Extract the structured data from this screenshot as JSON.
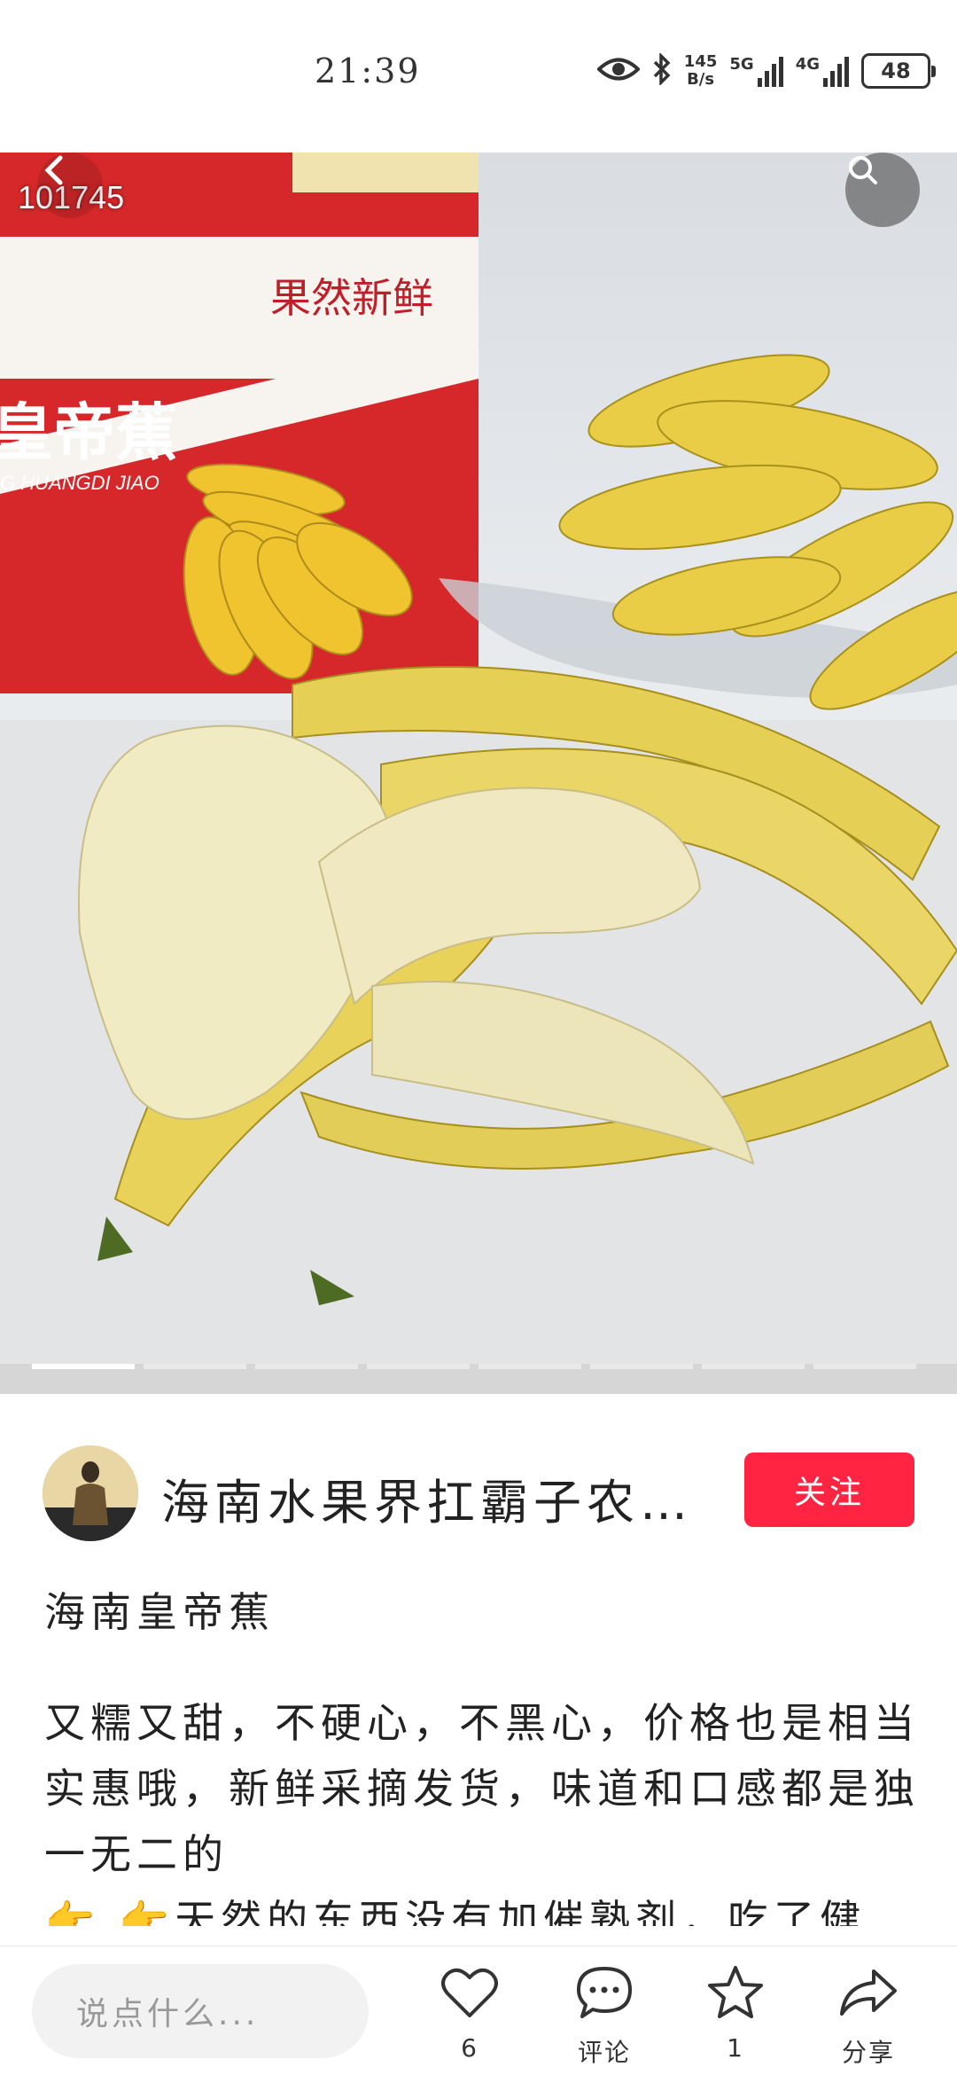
{
  "status_bar": {
    "time": "21:39",
    "net_speed_value": "145",
    "net_speed_unit": "B/s",
    "network_1": "5G",
    "network_2": "4G",
    "battery": "48"
  },
  "gallery": {
    "image_counter": "101745",
    "page_count": 8,
    "current_page": 1
  },
  "author": {
    "name": "海南水果界扛霸子农…",
    "follow_label": "关注"
  },
  "post": {
    "title": "海南皇帝蕉",
    "body": "又糯又甜，不硬心，不黑心，价格也是相当实惠哦，新鲜采摘发货，味道和口感都是独一无二的",
    "body_line4": "👉 👉天然的东西没有加催熟剂，吃了健"
  },
  "box_print": {
    "slogan": "果然新鲜",
    "brand": "皇帝蕉",
    "pinyin": "G HUANGDI JIAO"
  },
  "bottom_bar": {
    "comment_placeholder": "说点什么...",
    "like_count": "6",
    "comment_label": "评论",
    "collect_count": "1",
    "share_label": "分享"
  },
  "colors": {
    "accent": "#ff2442",
    "box_red": "#d6282a",
    "banana_yellow": "#e8cf4e"
  }
}
